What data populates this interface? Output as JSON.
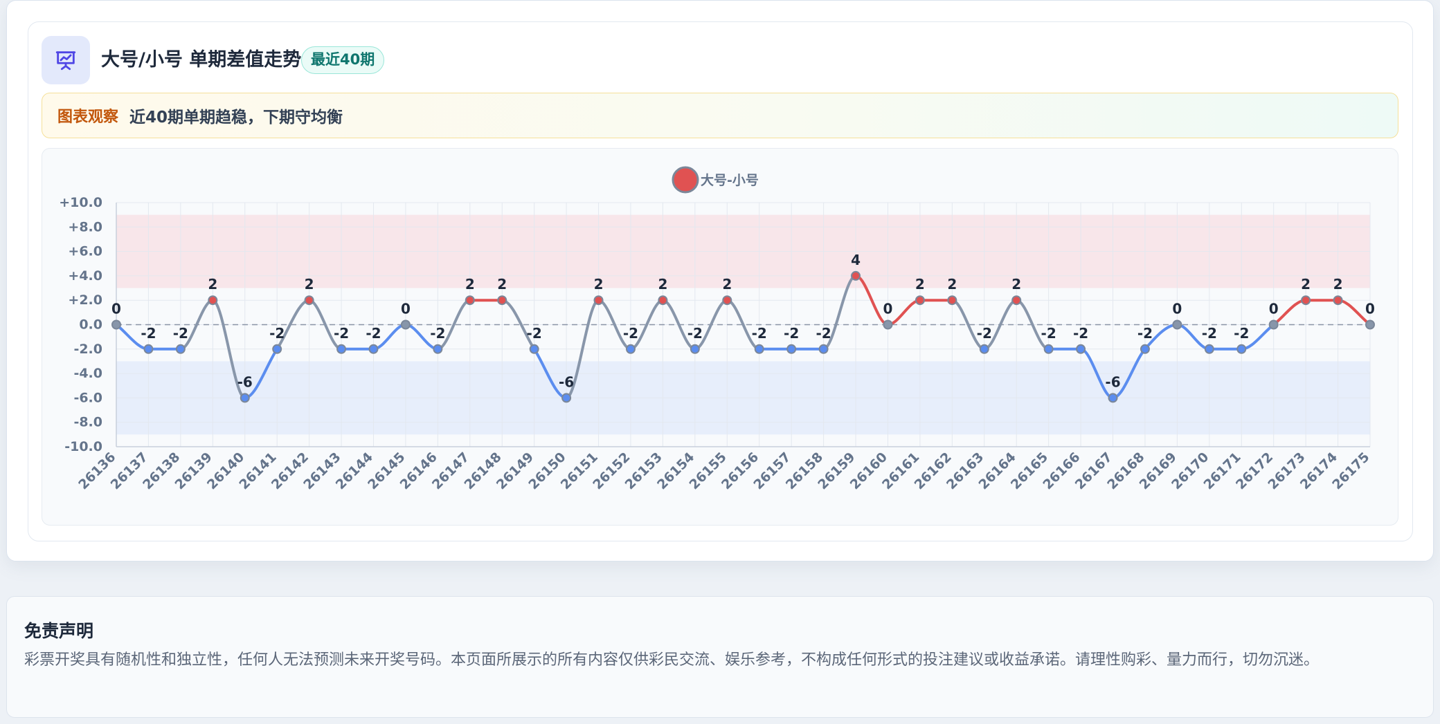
{
  "header": {
    "title": "大号/小号 单期差值走势",
    "badge": "最近40期",
    "icon": "presentation-chart-icon"
  },
  "insight": {
    "label": "图表观察",
    "text": "近40期单期趋稳，下期守均衡"
  },
  "disclaimer": {
    "title": "免责声明",
    "text": "彩票开奖具有随机性和独立性，任何人无法预测未来开奖号码。本页面所展示的所有内容仅供彩民交流、娱乐参考，不构成任何形式的投注建议或收益承诺。请理性购彩、量力而行，切勿沉迷。"
  },
  "colors": {
    "positive": "#e05252",
    "negative": "#5b8def",
    "neutral": "#8896aa",
    "accent": "#4f46e5",
    "badge_text": "#0f766e",
    "insight_label": "#c2570c"
  },
  "chart_data": {
    "type": "line",
    "title": "",
    "xlabel": "",
    "ylabel": "",
    "legend": {
      "position": "top-center",
      "label": "大号-小号"
    },
    "ylim": [
      -10,
      10
    ],
    "yticks": [
      -10,
      -8,
      -6,
      -4,
      -2,
      0,
      2,
      4,
      6,
      8,
      10
    ],
    "ytick_labels": [
      "-10.0",
      "-8.0",
      "-6.0",
      "-4.0",
      "-2.0",
      "0.0",
      "+2.0",
      "+4.0",
      "+6.0",
      "+8.0",
      "+10.0"
    ],
    "grid": true,
    "bands": [
      {
        "from": 3,
        "to": 9,
        "color": "#f8e6ea"
      },
      {
        "from": -9,
        "to": -3,
        "color": "#e7eefb"
      }
    ],
    "zero_line": true,
    "categories": [
      "26136",
      "26137",
      "26138",
      "26139",
      "26140",
      "26141",
      "26142",
      "26143",
      "26144",
      "26145",
      "26146",
      "26147",
      "26148",
      "26149",
      "26150",
      "26151",
      "26152",
      "26153",
      "26154",
      "26155",
      "26156",
      "26157",
      "26158",
      "26159",
      "26160",
      "26161",
      "26162",
      "26163",
      "26164",
      "26165",
      "26166",
      "26167",
      "26168",
      "26169",
      "26170",
      "26171",
      "26172",
      "26173",
      "26174",
      "26175"
    ],
    "series": [
      {
        "name": "大号-小号",
        "values": [
          0,
          -2,
          -2,
          2,
          -6,
          -2,
          2,
          -2,
          -2,
          0,
          -2,
          2,
          2,
          -2,
          -6,
          2,
          -2,
          2,
          -2,
          2,
          -2,
          -2,
          -2,
          4,
          0,
          2,
          2,
          -2,
          2,
          -2,
          -2,
          -6,
          -2,
          0,
          -2,
          -2,
          0,
          2,
          2,
          0
        ]
      }
    ]
  }
}
